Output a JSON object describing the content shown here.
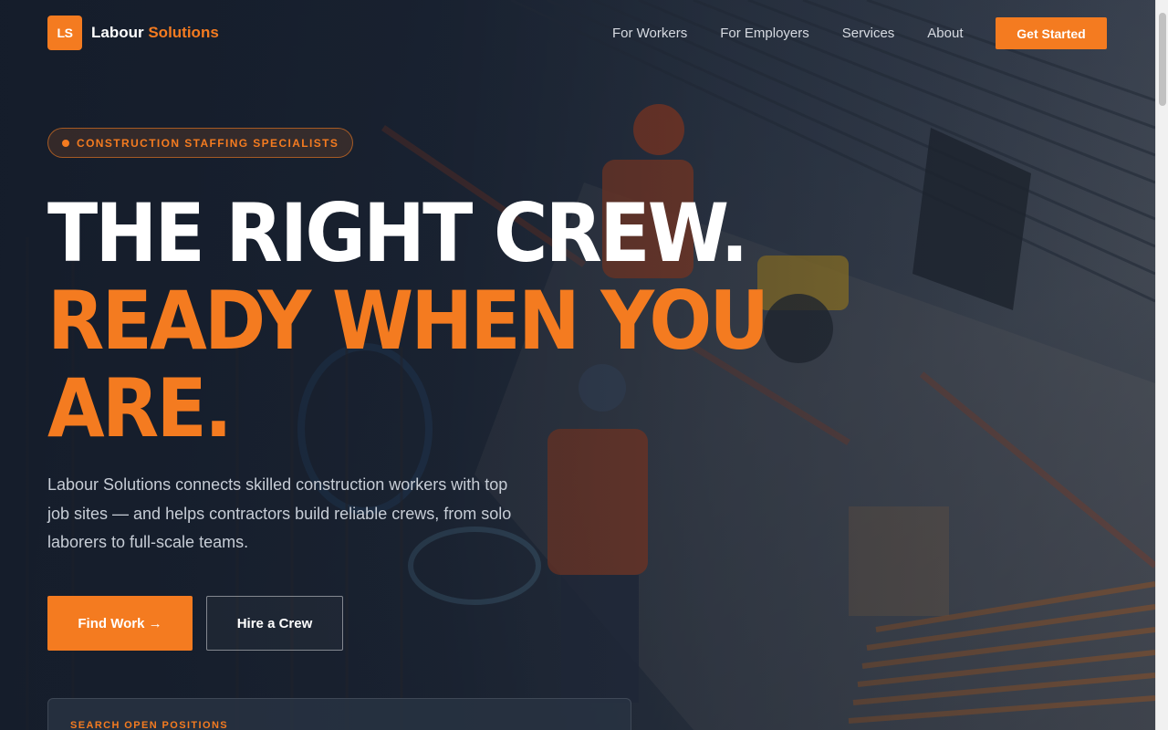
{
  "header": {
    "logo_mark": "LS",
    "brand_primary": "Labour",
    "brand_accent": "Solutions",
    "nav": [
      {
        "label": "For Workers"
      },
      {
        "label": "For Employers"
      },
      {
        "label": "Services"
      },
      {
        "label": "About"
      }
    ],
    "cta_label": "Get Started"
  },
  "hero": {
    "badge": "CONSTRUCTION STAFFING SPECIALISTS",
    "headline_line1": "THE RIGHT CREW.",
    "headline_line2": "READY WHEN YOU",
    "headline_line3": "ARE.",
    "lede": "Labour Solutions connects skilled construction workers with top job sites — and helps contractors build reliable crews, from solo laborers to full-scale teams.",
    "primary_button": "Find Work →",
    "secondary_button": "Hire a Crew"
  },
  "search": {
    "label": "SEARCH OPEN POSITIONS"
  },
  "colors": {
    "accent": "#f47b20",
    "background": "#1b2433",
    "text": "#ffffff"
  }
}
